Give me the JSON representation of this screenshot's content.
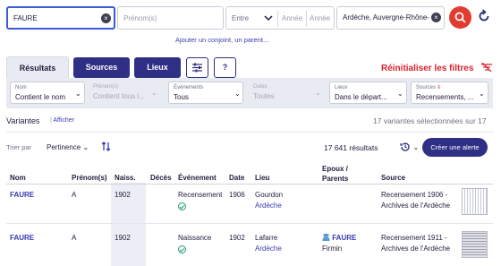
{
  "search": {
    "name_value": "FAURE",
    "firstname_placeholder": "Prénom(s)",
    "between_label": "Entre",
    "year_from_placeholder": "Année",
    "year_to_placeholder": "Année",
    "place_value": "Ardèche, Auvergne-Rhône-",
    "add_relative_link": "Ajouter un conjoint, un parent..."
  },
  "tabs": {
    "results": "Résultats",
    "sources": "Sources",
    "places": "Lieux",
    "help": "?"
  },
  "reset_filters": "Réinitialiser les filtres",
  "filters": [
    {
      "label": "Nom",
      "value": "Contient le nom",
      "enabled": true
    },
    {
      "label": "Prénom(s)",
      "value": "Contient tous l...",
      "enabled": false
    },
    {
      "label": "Événements",
      "value": "Tous",
      "enabled": true
    },
    {
      "label": "Dates",
      "value": "Toutes",
      "enabled": false
    },
    {
      "label": "Lieux",
      "value": "Dans le départ...",
      "enabled": true
    },
    {
      "label": "Sources",
      "value": "Recensements, ...",
      "enabled": true
    }
  ],
  "variants": {
    "label": "Variantes",
    "show_link": "Afficher",
    "selected_text": "17 variantes sélectionnées sur 17"
  },
  "sort": {
    "label": "Trier par",
    "value": "Pertinence"
  },
  "results_count": "17 641 résultats",
  "create_alert": "Créer une alerte",
  "columns": {
    "nom": "Nom",
    "prenom": "Prénom(s)",
    "naiss": "Naiss.",
    "deces": "Décès",
    "evenement": "Événement",
    "date": "Date",
    "lieu": "Lieu",
    "epoux_1": "Epoux /",
    "epoux_2": "Parents",
    "source": "Source"
  },
  "rows": [
    {
      "nom": "FAURE",
      "prenom": "A",
      "naiss": "1902",
      "deces": "",
      "evenement": "Recensement",
      "date": "1906",
      "lieu": "Gourdon",
      "lieu_dept": "Ardèche",
      "epoux_name": "",
      "epoux_first": "",
      "source_1": "Recensement 1906 -",
      "source_2": "Archives de l'Ardèche"
    },
    {
      "nom": "FAURE",
      "prenom": "A",
      "naiss": "1902",
      "deces": "",
      "evenement": "Naissance",
      "date": "1902",
      "lieu": "Lafarre",
      "lieu_dept": "Ardèche",
      "epoux_name": "FAURE",
      "epoux_first": "Firmin",
      "source_1": "Recensement 1911 -",
      "source_2": "Archives de l'Ardèche"
    }
  ],
  "colors": {
    "brand_dark": "#2f2f85",
    "accent_red": "#e23b30",
    "link_blue": "#3a3ab4",
    "success_green": "#1e9e6a"
  }
}
